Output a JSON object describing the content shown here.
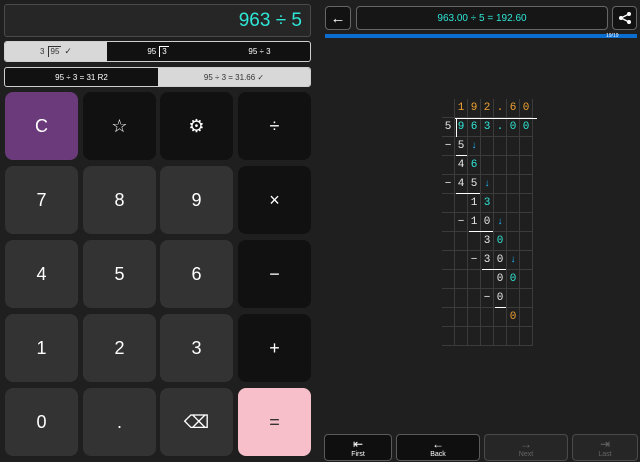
{
  "display": {
    "expression": "963 ÷ 5"
  },
  "format_tabs_1": [
    {
      "divisor": "3",
      "dividend": "95",
      "suffix": "✓",
      "selected": true
    },
    {
      "dividend": "95",
      "divisor": "3",
      "selected": false
    },
    {
      "label": "95 ÷ 3",
      "selected": false
    }
  ],
  "format_tabs_2": [
    {
      "label": "95 ÷ 3 = 31 R2",
      "selected": false
    },
    {
      "label": "95 ÷ 3 = 31.66 ✓",
      "selected": true
    }
  ],
  "keypad": {
    "clear": "C",
    "favorite": "☆",
    "settings": "⚙",
    "divide": "÷",
    "seven": "7",
    "eight": "8",
    "nine": "9",
    "multiply": "×",
    "four": "4",
    "five": "5",
    "six": "6",
    "minus": "−",
    "one": "1",
    "two": "2",
    "three": "3",
    "plus": "+",
    "zero": "0",
    "dot": ".",
    "backspace": "⌫",
    "equals": "="
  },
  "solution": {
    "back_icon": "←",
    "result": "963.00 ÷ 5 = 192.60",
    "step": "19/19",
    "progress": 1.0
  },
  "long_division": {
    "quotient": [
      "1",
      "9",
      "2",
      ".",
      "6",
      "0"
    ],
    "divisor": "5",
    "dividend": [
      "9",
      "6",
      "3",
      ".",
      "0",
      "0"
    ],
    "steps": [
      {
        "row": 2,
        "minus": "−",
        "digits": [
          "5"
        ],
        "arrow": "↓",
        "kind": "subtract"
      },
      {
        "row": 3,
        "digits": [
          "4",
          "6"
        ],
        "kind": "remainder"
      },
      {
        "row": 4,
        "minus": "−",
        "digits": [
          "4",
          "5"
        ],
        "arrow": "↓",
        "kind": "subtract"
      },
      {
        "row": 5,
        "digits": [
          "1",
          "3"
        ],
        "kind": "remainder"
      },
      {
        "row": 6,
        "minus": "−",
        "digits": [
          "1",
          "0"
        ],
        "arrow": "↓",
        "kind": "subtract"
      },
      {
        "row": 7,
        "digits": [
          "3",
          "0"
        ],
        "kind": "remainder"
      },
      {
        "row": 8,
        "minus": "−",
        "digits": [
          "3",
          "0"
        ],
        "arrow": "↓",
        "kind": "subtract"
      },
      {
        "row": 9,
        "digits": [
          "0",
          "0"
        ],
        "kind": "remainder"
      },
      {
        "row": 10,
        "minus": "−",
        "digits": [
          "0"
        ],
        "kind": "subtract"
      },
      {
        "row": 11,
        "digits": [
          "0"
        ],
        "kind": "final"
      }
    ]
  },
  "nav": {
    "first": {
      "icon": "⇤",
      "label": "First",
      "enabled": true
    },
    "back": {
      "icon": "←",
      "label": "Back",
      "enabled": true
    },
    "next": {
      "icon": "→",
      "label": "Next",
      "enabled": false
    },
    "last": {
      "icon": "⇥",
      "label": "Last",
      "enabled": false
    }
  },
  "colors": {
    "accent_cyan": "#2ee6d6",
    "quotient_orange": "#f0a030",
    "arrow_blue": "#1fb8ff",
    "clear_key": "#6b3a7a",
    "equals_key": "#f7bfca",
    "progress": "#0a6ed1"
  }
}
